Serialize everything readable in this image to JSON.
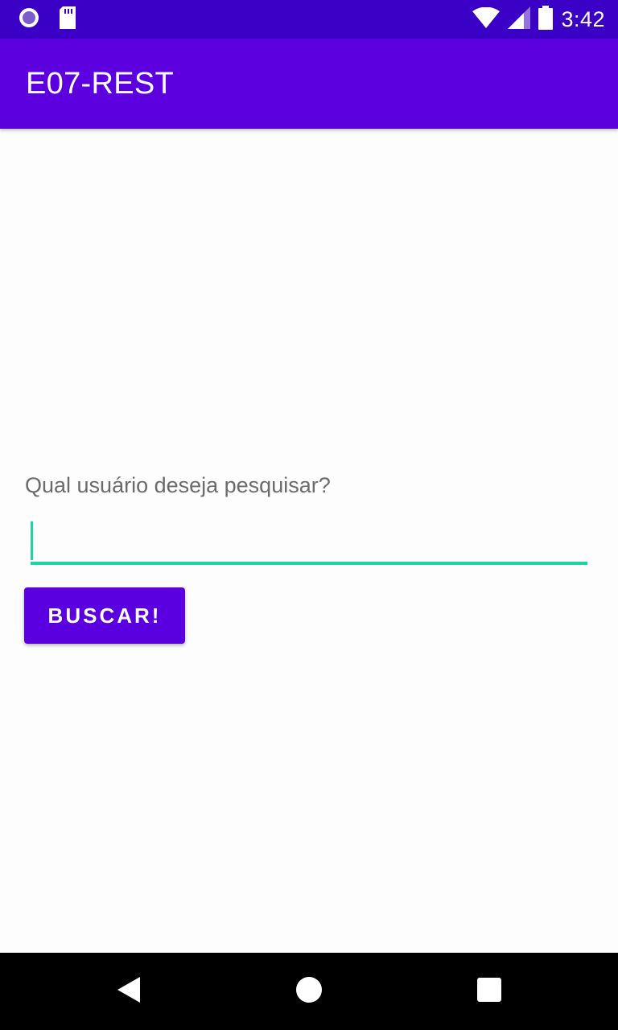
{
  "status_bar": {
    "time": "3:42",
    "icons_left": [
      "record-icon",
      "sd-card-icon"
    ],
    "icons_right": [
      "wifi-icon",
      "signal-icon",
      "battery-icon"
    ]
  },
  "app_bar": {
    "title": "E07-REST"
  },
  "form": {
    "prompt": "Qual usuário deseja pesquisar?",
    "input_value": "",
    "input_placeholder": "",
    "button_label": "BUSCAR!"
  },
  "nav_bar": {
    "buttons": [
      "back-icon",
      "home-icon",
      "recents-icon"
    ]
  },
  "colors": {
    "status_bar": "#3a00c5",
    "app_bar": "#5c00e0",
    "accent": "#1ed3a2",
    "button": "#5a00e0",
    "background": "#fdfdfe"
  }
}
